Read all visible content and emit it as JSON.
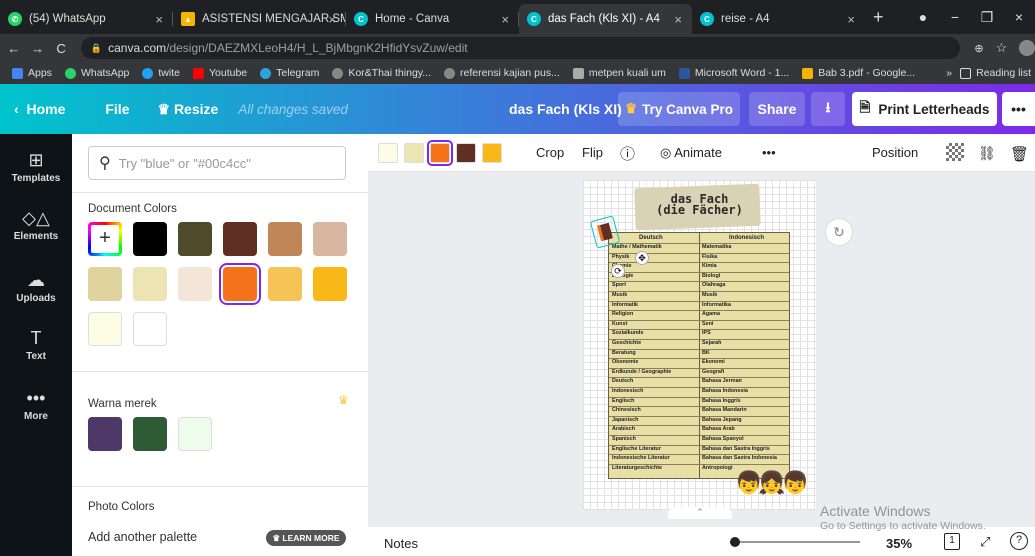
{
  "browser": {
    "tabs": [
      {
        "title": "(54) WhatsApp",
        "color": "#25d366",
        "active": false
      },
      {
        "title": "ASISTENSI MENGAJAR SMAI",
        "color": "#f4b400",
        "active": false
      },
      {
        "title": "Home - Canva",
        "color": "#00c4cc",
        "active": false
      },
      {
        "title": "das Fach (Kls XI) - A4",
        "color": "#00c4cc",
        "active": true
      },
      {
        "title": "reise - A4",
        "color": "#00c4cc",
        "active": false
      }
    ],
    "url_host": "canva.com",
    "url_path": "/design/DAEZMXLeoH4/H_L_BjMbgnK2HfidYsvZuw/edit",
    "bookmarks": [
      {
        "label": "Apps",
        "color": "#4285f4"
      },
      {
        "label": "WhatsApp",
        "color": "#25d366"
      },
      {
        "label": "twite",
        "color": "#1da1f2"
      },
      {
        "label": "Youtube",
        "color": "#ff0000"
      },
      {
        "label": "Telegram",
        "color": "#2aa3df"
      },
      {
        "label": "Kor&Thai thingy...",
        "color": "#888888"
      },
      {
        "label": "referensi kajian pus...",
        "color": "#888888"
      },
      {
        "label": "metpen kuali um",
        "color": "#aaaaaa"
      },
      {
        "label": "Microsoft Word - 1...",
        "color": "#2b579a"
      },
      {
        "label": "Bab 3.pdf - Google...",
        "color": "#f4b400"
      }
    ],
    "reading_list": "Reading list"
  },
  "topbar": {
    "home": "Home",
    "file": "File",
    "resize": "Resize",
    "saved": "All changes saved",
    "doc_title": "das Fach (Kls XI)",
    "try_pro": "Try Canva Pro",
    "share": "Share",
    "print": "Print Letterheads"
  },
  "sidebar": {
    "templates": "Templates",
    "elements": "Elements",
    "uploads": "Uploads",
    "text": "Text",
    "more": "More"
  },
  "panel": {
    "search_placeholder": "Try \"blue\" or \"#00c4cc\"",
    "doc_colors_title": "Document Colors",
    "doc_colors": [
      "#000000",
      "#4f4a2a",
      "#5f2f24",
      "#c08658",
      "#d8b6a0",
      "#e0d49e",
      "#ede4b4",
      "#f3e6d8",
      "#f4731a",
      "#f6c456",
      "#f8b81a",
      "#fdfce4",
      "#ffffff"
    ],
    "brand_title": "Warna merek",
    "brand_colors": [
      "#4e3868",
      "#2e5b34",
      "#eefcec"
    ],
    "photo_title": "Photo Colors",
    "add_palette": "Add another palette",
    "learn_more": "LEARN MORE"
  },
  "toolbar": {
    "swatches": [
      "#fdfce4",
      "#ede4b4",
      "#f4731a",
      "#5f2f24",
      "#f8b81a"
    ],
    "crop": "Crop",
    "flip": "Flip",
    "animate": "Animate",
    "position": "Position"
  },
  "design": {
    "title_line1": "das Fach",
    "title_line2": "(die Fächer)",
    "header_de": "Deutsch",
    "header_id": "Indonesisch",
    "rows": [
      [
        "Mathe / Mathematik",
        "Matematika"
      ],
      [
        "Physik",
        "Fisika"
      ],
      [
        "Chemie",
        "Kimia"
      ],
      [
        "Biologie",
        "Biologi"
      ],
      [
        "Sport",
        "Olahraga"
      ],
      [
        "Musik",
        "Musik"
      ],
      [
        "Informatik",
        "Informatika"
      ],
      [
        "Religion",
        "Agama"
      ],
      [
        "Kunst",
        "Seni"
      ],
      [
        "Sozialkunde",
        "IPS"
      ],
      [
        "Geschichte",
        "Sejarah"
      ],
      [
        "Beratung",
        "BK"
      ],
      [
        "Ökonomie",
        "Ekonomi"
      ],
      [
        "Erdkunde / Geographie",
        "Geografi"
      ],
      [
        "Deutsch",
        "Bahasa Jerman"
      ],
      [
        "Indonesisch",
        "Bahasa Indonesia"
      ],
      [
        "Englisch",
        "Bahasa Inggris"
      ],
      [
        "Chinesisch",
        "Bahasa Mandarin"
      ],
      [
        "Japanisch",
        "Bahasa Jepang"
      ],
      [
        "Arabisch",
        "Bahasa Arab"
      ],
      [
        "Spanisch",
        "Bahasa Spanyol"
      ],
      [
        "Englische Literatur",
        "Bahasa dan Sastra Inggris"
      ],
      [
        "Indonesische Literatur",
        "Bahasa dan Sastra Indonesia"
      ],
      [
        "Literaturgeschichte",
        "Antropologi"
      ]
    ]
  },
  "bottombar": {
    "notes": "Notes",
    "zoom": "35%",
    "page": "1"
  },
  "watermark": {
    "line1": "Activate Windows",
    "line2": "Go to Settings to activate Windows."
  }
}
